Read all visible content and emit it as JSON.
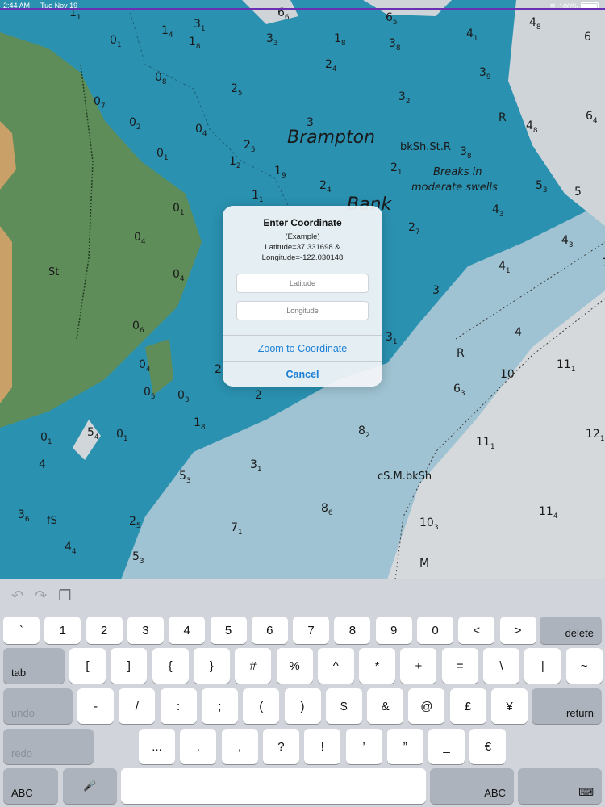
{
  "status_bar": {
    "time": "2:44 AM",
    "date": "Tue Nov 19",
    "battery": "100%"
  },
  "chart": {
    "place_names": [
      "Brampton",
      "Bank",
      "Breaks in",
      "moderate swells"
    ],
    "seabed_labels": [
      "bkSh.St.R",
      "cS.M.bkSh",
      "St",
      "fS"
    ],
    "soundings": [
      {
        "v": "1",
        "s": "1"
      },
      {
        "v": "1",
        "s": "4"
      },
      {
        "v": "3",
        "s": "1"
      },
      {
        "v": "1",
        "s": "8"
      },
      {
        "v": "6",
        "s": "6"
      },
      {
        "v": "6",
        "s": "5"
      },
      {
        "v": "4",
        "s": "8"
      },
      {
        "v": "6",
        "s": ""
      },
      {
        "v": "0",
        "s": "1"
      },
      {
        "v": "3",
        "s": "3"
      },
      {
        "v": "1",
        "s": "8"
      },
      {
        "v": "3",
        "s": "8"
      },
      {
        "v": "4",
        "s": "1"
      },
      {
        "v": "0",
        "s": "8"
      },
      {
        "v": "2",
        "s": "4"
      },
      {
        "v": "3",
        "s": "9"
      },
      {
        "v": "0",
        "s": "7"
      },
      {
        "v": "2",
        "s": "5"
      },
      {
        "v": "3",
        "s": "2"
      },
      {
        "v": "R",
        "s": ""
      },
      {
        "v": "6",
        "s": "4"
      },
      {
        "v": "0",
        "s": "2"
      },
      {
        "v": "0",
        "s": "4"
      },
      {
        "v": "3",
        "s": ""
      },
      {
        "v": "4",
        "s": "8"
      },
      {
        "v": "0",
        "s": "1"
      },
      {
        "v": "2",
        "s": "5"
      },
      {
        "v": "3",
        "s": "8"
      },
      {
        "v": "1",
        "s": "2"
      },
      {
        "v": "1",
        "s": "9"
      },
      {
        "v": "2",
        "s": "1"
      },
      {
        "v": "5",
        "s": "3"
      },
      {
        "v": "5",
        "s": ""
      },
      {
        "v": "2",
        "s": "4"
      },
      {
        "v": "1",
        "s": "1"
      },
      {
        "v": "0",
        "s": "1"
      },
      {
        "v": "4",
        "s": "3"
      },
      {
        "v": "0",
        "s": "4"
      },
      {
        "v": "2",
        "s": "7"
      },
      {
        "v": "4",
        "s": "3"
      },
      {
        "v": "0",
        "s": "4"
      },
      {
        "v": "4",
        "s": "1"
      },
      {
        "v": "1",
        "s": ""
      },
      {
        "v": "3",
        "s": ""
      },
      {
        "v": "0",
        "s": "6"
      },
      {
        "v": "3",
        "s": "1"
      },
      {
        "v": "4",
        "s": ""
      },
      {
        "v": "R",
        "s": ""
      },
      {
        "v": "0",
        "s": "4"
      },
      {
        "v": "2",
        "s": ""
      },
      {
        "v": "10",
        "s": ""
      },
      {
        "v": "11",
        "s": "1"
      },
      {
        "v": "6",
        "s": "3"
      },
      {
        "v": "0",
        "s": "5"
      },
      {
        "v": "0",
        "s": "3"
      },
      {
        "v": "2",
        "s": ""
      },
      {
        "v": "1",
        "s": "8"
      },
      {
        "v": "8",
        "s": "2"
      },
      {
        "v": "11",
        "s": "1"
      },
      {
        "v": "12",
        "s": "1"
      },
      {
        "v": "5",
        "s": "4"
      },
      {
        "v": "0",
        "s": "1"
      },
      {
        "v": "0",
        "s": "1"
      },
      {
        "v": "4",
        "s": ""
      },
      {
        "v": "3",
        "s": "1"
      },
      {
        "v": "5",
        "s": "3"
      },
      {
        "v": "3",
        "s": "6"
      },
      {
        "v": "8",
        "s": "6"
      },
      {
        "v": "11",
        "s": "4"
      },
      {
        "v": "2",
        "s": "5"
      },
      {
        "v": "7",
        "s": "1"
      },
      {
        "v": "10",
        "s": "3"
      },
      {
        "v": "4",
        "s": "4"
      },
      {
        "v": "5",
        "s": "3"
      },
      {
        "v": "M",
        "s": ""
      }
    ]
  },
  "dialog": {
    "title": "Enter Coordinate",
    "message_line1": "(Example)",
    "message_line2": "Latitude=37.331698 &",
    "message_line3": "Longitude=-122.030148",
    "latitude_placeholder": "Latitude",
    "longitude_placeholder": "Longitude",
    "zoom_button": "Zoom to Coordinate",
    "cancel_button": "Cancel"
  },
  "keyboard": {
    "toolbar": [
      "undo-icon",
      "redo-icon",
      "paste-icon"
    ],
    "row1": [
      "`",
      "1",
      "2",
      "3",
      "4",
      "5",
      "6",
      "7",
      "8",
      "9",
      "0",
      "<",
      ">"
    ],
    "delete": "delete",
    "tab": "tab",
    "row2": [
      "[",
      "]",
      "{",
      "}",
      "#",
      "%",
      "^",
      "*",
      "+",
      "=",
      "\\",
      "|",
      "~"
    ],
    "undo": "undo",
    "row3": [
      "-",
      "/",
      ":",
      ";",
      "(",
      ")",
      "$",
      "&",
      "@",
      "£",
      "¥"
    ],
    "return": "return",
    "redo": "redo",
    "row4": [
      "...",
      ".",
      ",",
      "?",
      "!",
      "’",
      "”",
      "_",
      "€"
    ],
    "abc_left": "ABC",
    "abc_right": "ABC",
    "mic_icon": "microphone-icon",
    "hide_icon": "keyboard-dismiss-icon"
  }
}
